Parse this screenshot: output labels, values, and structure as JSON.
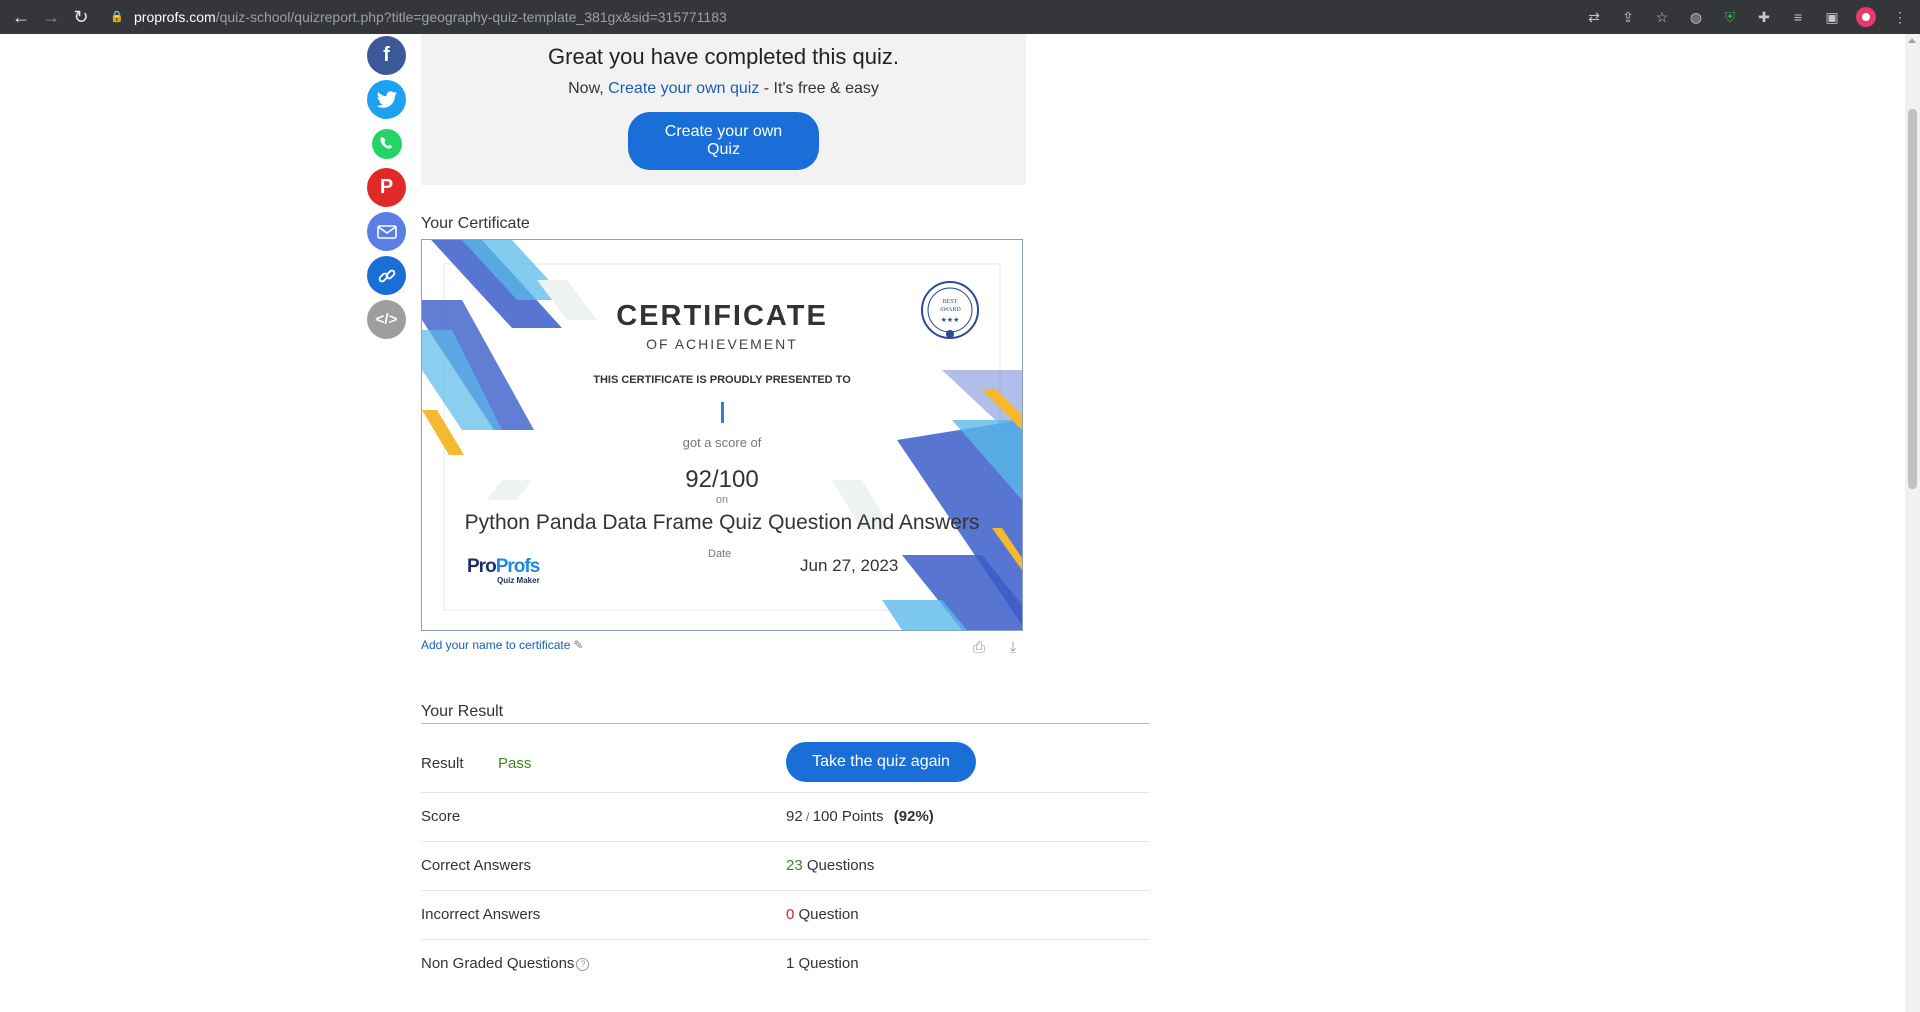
{
  "browser": {
    "url_host": "proprofs.com",
    "url_path": "/quiz-school/quizreport.php?title=geography-quiz-template_381gx&sid=315771183"
  },
  "share_icons": [
    "facebook-icon",
    "twitter-icon",
    "whatsapp-icon",
    "pinterest-icon",
    "email-icon",
    "link-icon",
    "embed-icon"
  ],
  "completed": {
    "heading": "Great you have completed this quiz.",
    "sub_prefix": "Now, ",
    "sub_link": "Create your own quiz",
    "sub_suffix": " - It's free & easy",
    "button": "Create your own Quiz"
  },
  "certificate": {
    "label": "Your Certificate",
    "title": "CERTIFICATE",
    "subtitle": "OF ACHIEVEMENT",
    "presented": "THIS CERTIFICATE IS PROUDLY PRESENTED TO",
    "score_intro": "got a score of",
    "score": "92/100",
    "on": "on",
    "quiz_name": "Python Panda Data Frame Quiz Question And Answers",
    "date_label": "Date",
    "date": "Jun 27, 2023",
    "badge_line1": "BEST",
    "badge_line2": "AWARD",
    "logo_pro": "Pro",
    "logo_profs": "Profs",
    "logo_sub": "Quiz Maker",
    "add_name": "Add your name to certificate"
  },
  "result": {
    "heading": "Your Result",
    "result_label": "Result",
    "result_value": "Pass",
    "retake_button": "Take the quiz again",
    "score_label": "Score",
    "score_points": "92",
    "score_sep": " / ",
    "score_total": "100 Points",
    "score_pct": "(92%)",
    "correct_label": "Correct Answers",
    "correct_count": "23",
    "correct_unit": " Questions",
    "incorrect_label": "Incorrect Answers",
    "incorrect_count": "0",
    "incorrect_unit": " Question",
    "nongraded_label": "Non Graded Questions",
    "nongraded_help": "?",
    "nongraded_value": "1 Question"
  },
  "colors": {
    "facebook": "#3b5998",
    "twitter": "#1da1f2",
    "whatsapp": "#25d366",
    "pinterest": "#e02a2a",
    "email": "#5b7ee5",
    "link": "#1a6ed8",
    "embed": "#9e9e9e"
  }
}
